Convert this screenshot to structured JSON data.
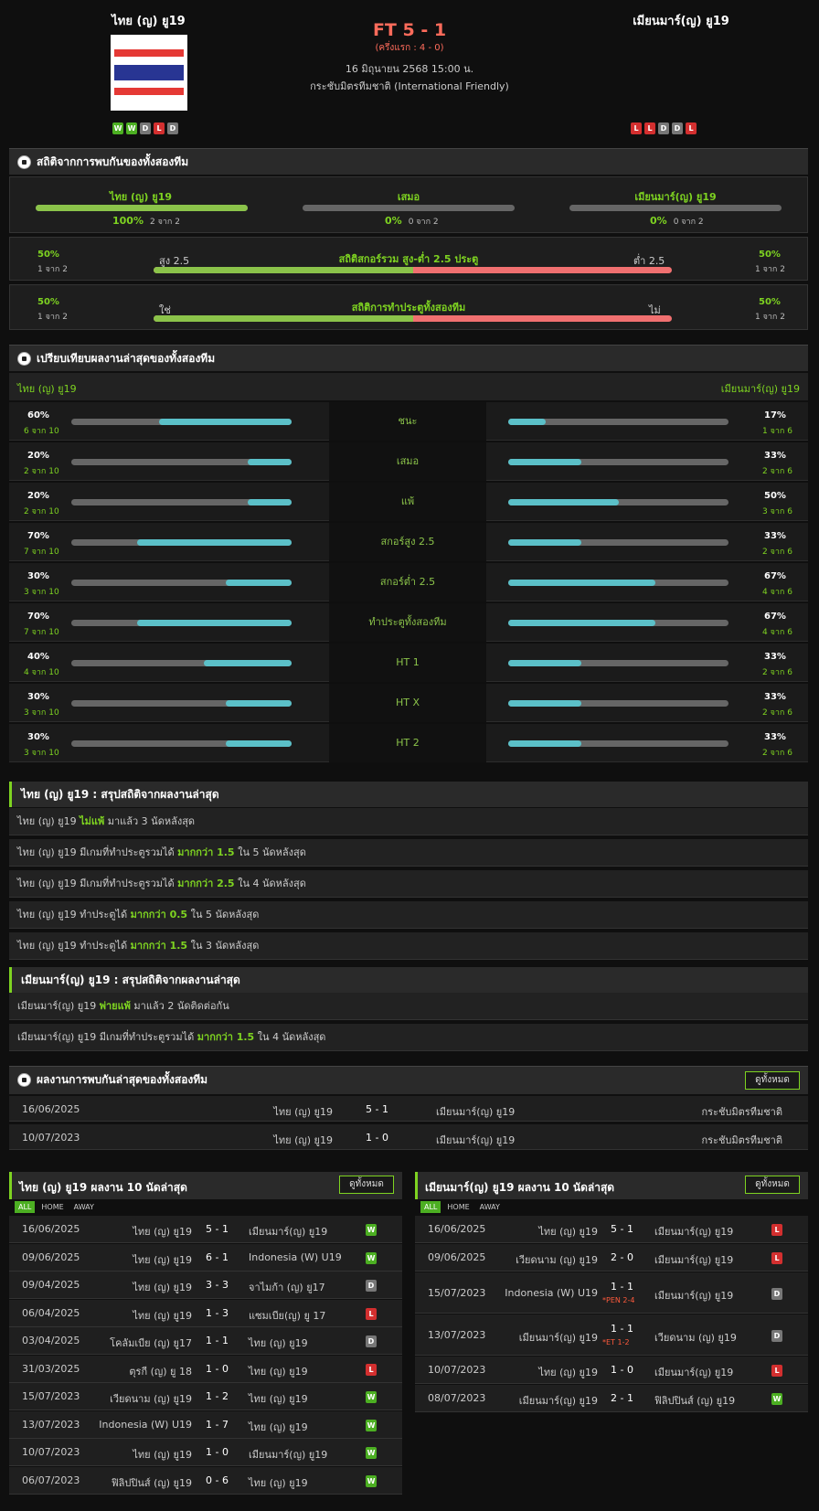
{
  "match": {
    "home": "ไทย (ญ) ยู19",
    "away": "เมียนมาร์(ญ) ยู19",
    "score": "FT 5 - 1",
    "half": "(ครึ่งแรก : 4 - 0)",
    "date": "16 มิถุนายน 2568 15:00 น.",
    "competition": "กระชับมิตรทีมชาติ (International Friendly)",
    "home_form": [
      "W",
      "W",
      "D",
      "L",
      "D"
    ],
    "away_form": [
      "L",
      "L",
      "D",
      "D",
      "L"
    ]
  },
  "h2h_stats": {
    "title": "สถิติจากการพบกันของทั้งสองทีม",
    "home": {
      "label": "ไทย (ญ) ยู19",
      "pct": "100%",
      "sub": "2 จาก 2",
      "fill": 1.0
    },
    "draw": {
      "label": "เสมอ",
      "pct": "0%",
      "sub": "0 จาก 2",
      "fill": 0
    },
    "away": {
      "label": "เมียนมาร์(ญ) ยู19",
      "pct": "0%",
      "sub": "0 จาก 2",
      "fill": 0
    },
    "ou": {
      "title": "สถิติสกอร์รวม สูง-ต่ำ 2.5 ประตู",
      "left": "สูง 2.5",
      "right": "ต่ำ 2.5",
      "lp": "50%",
      "ls": "1 จาก 2",
      "rp": "50%",
      "rs": "1 จาก 2",
      "fill": 0.5
    },
    "btts": {
      "title": "สถิติการทำประตูทั้งสองทีม",
      "left": "ใช่",
      "right": "ไม่",
      "lp": "50%",
      "ls": "1 จาก 2",
      "rp": "50%",
      "rs": "1 จาก 2",
      "fill": 0.5
    }
  },
  "compare": {
    "title": "เปรียบเทียบผลงานล่าสุดของทั้งสองทีม",
    "home": "ไทย (ญ) ยู19",
    "away": "เมียนมาร์(ญ) ยู19",
    "rows": [
      {
        "label": "ชนะ",
        "hp": "60%",
        "hs": "6 จาก 10",
        "hv": 0.6,
        "ap": "17%",
        "as": "1 จาก 6",
        "av": 0.17
      },
      {
        "label": "เสมอ",
        "hp": "20%",
        "hs": "2 จาก 10",
        "hv": 0.2,
        "ap": "33%",
        "as": "2 จาก 6",
        "av": 0.33
      },
      {
        "label": "แพ้",
        "hp": "20%",
        "hs": "2 จาก 10",
        "hv": 0.2,
        "ap": "50%",
        "as": "3 จาก 6",
        "av": 0.5
      },
      {
        "label": "สกอร์สูง 2.5",
        "hp": "70%",
        "hs": "7 จาก 10",
        "hv": 0.7,
        "ap": "33%",
        "as": "2 จาก 6",
        "av": 0.33
      },
      {
        "label": "สกอร์ต่ำ 2.5",
        "hp": "30%",
        "hs": "3 จาก 10",
        "hv": 0.3,
        "ap": "67%",
        "as": "4 จาก 6",
        "av": 0.67
      },
      {
        "label": "ทำประตูทั้งสองทีม",
        "hp": "70%",
        "hs": "7 จาก 10",
        "hv": 0.7,
        "ap": "67%",
        "as": "4 จาก 6",
        "av": 0.67
      },
      {
        "label": "HT 1",
        "hp": "40%",
        "hs": "4 จาก 10",
        "hv": 0.4,
        "ap": "33%",
        "as": "2 จาก 6",
        "av": 0.33
      },
      {
        "label": "HT X",
        "hp": "30%",
        "hs": "3 จาก 10",
        "hv": 0.3,
        "ap": "33%",
        "as": "2 จาก 6",
        "av": 0.33
      },
      {
        "label": "HT 2",
        "hp": "30%",
        "hs": "3 จาก 10",
        "hv": 0.3,
        "ap": "33%",
        "as": "2 จาก 6",
        "av": 0.33
      }
    ]
  },
  "home_summary": {
    "title": "ไทย (ญ) ยู19 : สรุปสถิติจากผลงานล่าสุด",
    "lines": [
      [
        "ไทย (ญ) ยู19 ",
        "ไม่แพ้",
        " มาแล้ว 3 นัดหลังสุด"
      ],
      [
        "ไทย (ญ) ยู19 มีเกมที่ทำประตูรวมได้ ",
        "มากกว่า 1.5",
        " ใน 5 นัดหลังสุด"
      ],
      [
        "ไทย (ญ) ยู19 มีเกมที่ทำประตูรวมได้ ",
        "มากกว่า 2.5",
        " ใน 4 นัดหลังสุด"
      ],
      [
        "ไทย (ญ) ยู19 ทำประตูได้ ",
        "มากกว่า 0.5",
        " ใน 5 นัดหลังสุด"
      ],
      [
        "ไทย (ญ) ยู19 ทำประตูได้ ",
        "มากกว่า 1.5",
        " ใน 3 นัดหลังสุด"
      ]
    ]
  },
  "away_summary": {
    "title": "เมียนมาร์(ญ) ยู19 : สรุปสถิติจากผลงานล่าสุด",
    "lines": [
      [
        "เมียนมาร์(ญ) ยู19 ",
        "พ่ายแพ้",
        " มาแล้ว 2 นัดติดต่อกัน"
      ],
      [
        "เมียนมาร์(ญ) ยู19 มีเกมที่ทำประตูรวมได้ ",
        "มากกว่า 1.5",
        " ใน 4 นัดหลังสุด"
      ]
    ]
  },
  "h2h": {
    "title": "ผลงานการพบกันล่าสุดของทั้งสองทีม",
    "view_all": "ดูทั้งหมด",
    "rows": [
      {
        "date": "16/06/2025",
        "home": "ไทย (ญ) ยู19",
        "score": "5 - 1",
        "away": "เมียนมาร์(ญ) ยู19",
        "comp": "กระชับมิตรทีมชาติ"
      },
      {
        "date": "10/07/2023",
        "home": "ไทย (ญ) ยู19",
        "score": "1 - 0",
        "away": "เมียนมาร์(ญ) ยู19",
        "comp": "กระชับมิตรทีมชาติ"
      }
    ]
  },
  "last_home": {
    "title": "ไทย (ญ) ยู19 ผลงาน 10 นัดล่าสุด",
    "view_all": "ดูทั้งหมด",
    "tabs": [
      "ALL",
      "HOME",
      "AWAY"
    ],
    "rows": [
      {
        "date": "16/06/2025",
        "home": "ไทย (ญ) ยู19",
        "score": "5 - 1",
        "away": "เมียนมาร์(ญ) ยู19",
        "r": "W"
      },
      {
        "date": "09/06/2025",
        "home": "ไทย (ญ) ยู19",
        "score": "6 - 1",
        "away": "Indonesia (W) U19",
        "r": "W"
      },
      {
        "date": "09/04/2025",
        "home": "ไทย (ญ) ยู19",
        "score": "3 - 3",
        "away": "จาไมก้า (ญ) ยู17",
        "r": "D"
      },
      {
        "date": "06/04/2025",
        "home": "ไทย (ญ) ยู19",
        "score": "1 - 3",
        "away": "แซมเบีย(ญ) ยู 17",
        "r": "L"
      },
      {
        "date": "03/04/2025",
        "home": "โคลัมเบีย (ญ) ยู17",
        "score": "1 - 1",
        "away": "ไทย (ญ) ยู19",
        "r": "D"
      },
      {
        "date": "31/03/2025",
        "home": "ตุรกี (ญ) ยู 18",
        "score": "1 - 0",
        "away": "ไทย (ญ) ยู19",
        "r": "L"
      },
      {
        "date": "15/07/2023",
        "home": "เวียดนาม (ญ) ยู19",
        "score": "1 - 2",
        "away": "ไทย (ญ) ยู19",
        "r": "W"
      },
      {
        "date": "13/07/2023",
        "home": "Indonesia (W) U19",
        "score": "1 - 7",
        "away": "ไทย (ญ) ยู19",
        "r": "W"
      },
      {
        "date": "10/07/2023",
        "home": "ไทย (ญ) ยู19",
        "score": "1 - 0",
        "away": "เมียนมาร์(ญ) ยู19",
        "r": "W"
      },
      {
        "date": "06/07/2023",
        "home": "ฟิลิปปินส์ (ญ) ยู19",
        "score": "0 - 6",
        "away": "ไทย (ญ) ยู19",
        "r": "W"
      }
    ]
  },
  "last_away": {
    "title": "เมียนมาร์(ญ) ยู19 ผลงาน 10 นัดล่าสุด",
    "view_all": "ดูทั้งหมด",
    "tabs": [
      "ALL",
      "HOME",
      "AWAY"
    ],
    "rows": [
      {
        "date": "16/06/2025",
        "home": "ไทย (ญ) ยู19",
        "score": "5 - 1",
        "note": "",
        "away": "เมียนมาร์(ญ) ยู19",
        "r": "L"
      },
      {
        "date": "09/06/2025",
        "home": "เวียดนาม (ญ) ยู19",
        "score": "2 - 0",
        "note": "",
        "away": "เมียนมาร์(ญ) ยู19",
        "r": "L"
      },
      {
        "date": "15/07/2023",
        "home": "Indonesia (W) U19",
        "score": "1 - 1",
        "note": "*PEN 2-4",
        "away": "เมียนมาร์(ญ) ยู19",
        "r": "D"
      },
      {
        "date": "13/07/2023",
        "home": "เมียนมาร์(ญ) ยู19",
        "score": "1 - 1",
        "note": "*ET 1-2",
        "away": "เวียดนาม (ญ) ยู19",
        "r": "D"
      },
      {
        "date": "10/07/2023",
        "home": "ไทย (ญ) ยู19",
        "score": "1 - 0",
        "note": "",
        "away": "เมียนมาร์(ญ) ยู19",
        "r": "L"
      },
      {
        "date": "08/07/2023",
        "home": "เมียนมาร์(ญ) ยู19",
        "score": "2 - 1",
        "note": "",
        "away": "ฟิลิปปินส์ (ญ) ยู19",
        "r": "W"
      }
    ]
  }
}
